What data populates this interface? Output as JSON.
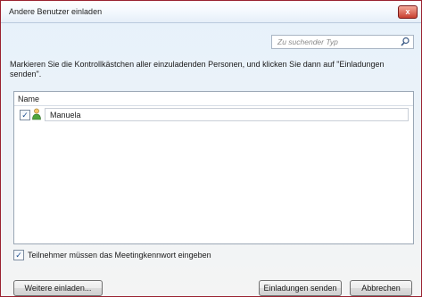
{
  "window": {
    "title": "Andere Benutzer einladen",
    "close_label": "x"
  },
  "search": {
    "placeholder": "Zu suchender Typ"
  },
  "instruction": "Markieren Sie die Kontrollkästchen aller einzuladenden Personen, und klicken Sie dann auf \"Einladungen senden\".",
  "list": {
    "header": "Name",
    "rows": [
      {
        "name": "Manuela",
        "checked": true,
        "icon": "person-icon"
      }
    ]
  },
  "password_option": {
    "label": "Teilnehmer müssen das Meetingkennwort eingeben",
    "checked": true
  },
  "buttons": {
    "more": "Weitere einladen...",
    "send": "Einladungen senden",
    "cancel": "Abbrechen"
  },
  "colors": {
    "frame_border": "#9a2230",
    "close_button": "#c8402f",
    "window_background": "#e6f1fb"
  }
}
